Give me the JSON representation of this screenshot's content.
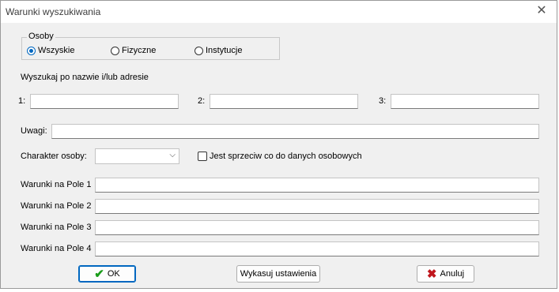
{
  "window": {
    "title": "Warunki wyszukiwania",
    "close_glyph": "✕"
  },
  "osoby": {
    "legend": "Osoby",
    "options": [
      {
        "label": "Wszyskie",
        "checked": true
      },
      {
        "label": "Fizyczne",
        "checked": false
      },
      {
        "label": "Instytucje",
        "checked": false
      }
    ]
  },
  "search": {
    "heading": "Wyszukaj po nazwie i/lub adresie",
    "fields": [
      {
        "label": "1:",
        "value": ""
      },
      {
        "label": "2:",
        "value": ""
      },
      {
        "label": "3:",
        "value": ""
      }
    ]
  },
  "uwagi": {
    "label": "Uwagi:",
    "value": ""
  },
  "charakter": {
    "label": "Charakter osoby:",
    "value": "",
    "chevron": "⌵"
  },
  "sprzeciw": {
    "label": "Jest sprzeciw co do danych osobowych",
    "checked": false
  },
  "warunki": [
    {
      "label": "Warunki na Pole 1",
      "value": ""
    },
    {
      "label": "Warunki na Pole 2",
      "value": ""
    },
    {
      "label": "Warunki na Pole 3",
      "value": ""
    },
    {
      "label": "Warunki na Pole 4",
      "value": ""
    }
  ],
  "buttons": {
    "ok": {
      "label": "OK",
      "icon": "✔",
      "icon_color": "#1a9c1a"
    },
    "reset": {
      "label": "Wykasuj ustawienia"
    },
    "cancel": {
      "label": "Anuluj",
      "icon": "✖",
      "icon_color": "#c0161c"
    }
  }
}
